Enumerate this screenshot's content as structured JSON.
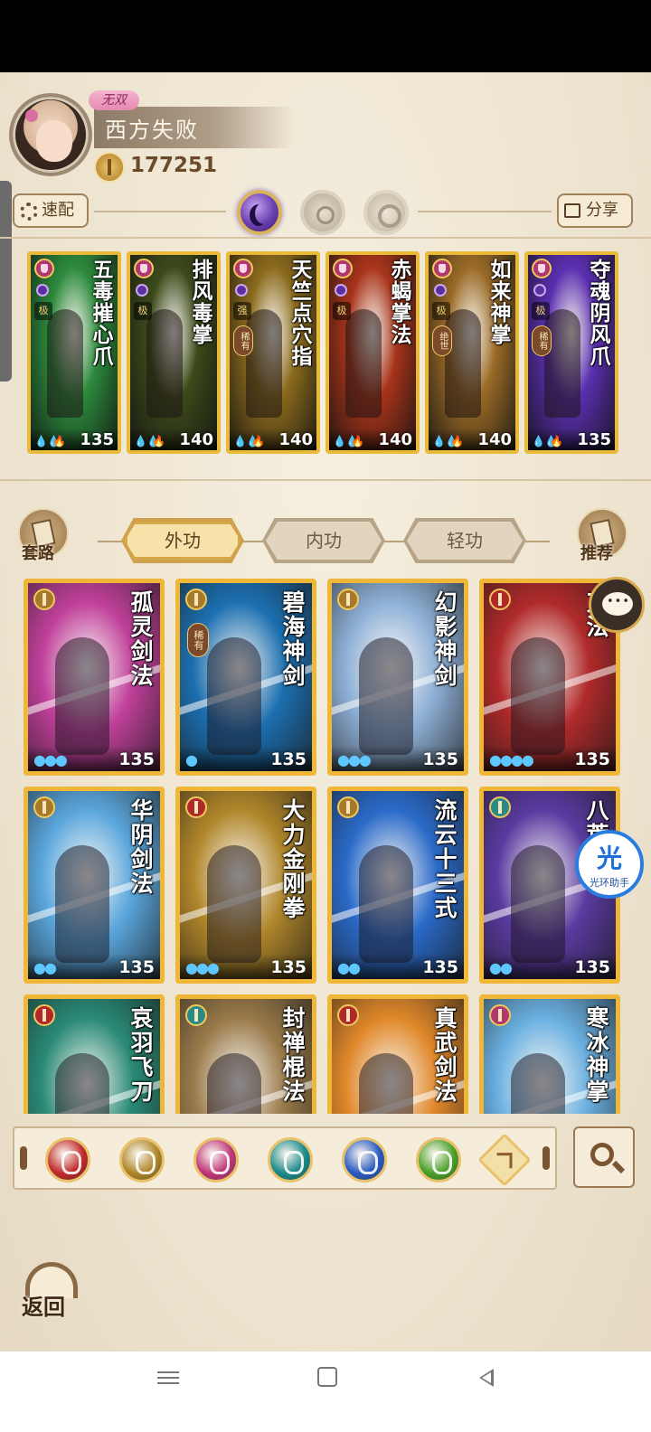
{
  "profile": {
    "title_badge": "无双",
    "player_name": "西方失败",
    "power": "177251"
  },
  "toolbar": {
    "quick_config_label": "速配",
    "share_label": "分享"
  },
  "equipped": [
    {
      "name": "五毒摧心爪",
      "grade": "极",
      "rarity": "",
      "level": "135",
      "bg": "#2c8a3c"
    },
    {
      "name": "排风毒掌",
      "grade": "极",
      "rarity": "",
      "level": "140",
      "bg": "#3c4a1a"
    },
    {
      "name": "天竺点穴指",
      "grade": "强",
      "rarity": "稀有",
      "level": "140",
      "bg": "#8a6a1c"
    },
    {
      "name": "赤蝎掌法",
      "grade": "极",
      "rarity": "",
      "level": "140",
      "bg": "#a8341a"
    },
    {
      "name": "如来神掌",
      "grade": "极",
      "rarity": "绝世",
      "level": "140",
      "bg": "#9a6a26"
    },
    {
      "name": "夺魂阴风爪",
      "grade": "极",
      "rarity": "稀有",
      "level": "135",
      "bg": "#5a2fb0"
    }
  ],
  "side": {
    "left_label": "套路",
    "right_label": "推荐"
  },
  "tabs": [
    {
      "label": "外功",
      "active": true
    },
    {
      "label": "内功",
      "active": false
    },
    {
      "label": "轻功",
      "active": false
    }
  ],
  "skills": [
    {
      "name": "孤灵剑法",
      "rarity": "",
      "level": "135",
      "drops": "999",
      "bg": "#c0409a",
      "badge": "#a67a2a"
    },
    {
      "name": "碧海神剑",
      "rarity": "稀有",
      "level": "135",
      "drops": "9",
      "bg": "#1c6fb0",
      "badge": "#a67a2a"
    },
    {
      "name": "幻影神剑",
      "rarity": "",
      "level": "135",
      "drops": "999",
      "bg": "#8eb0d6",
      "badge": "#a67a2a"
    },
    {
      "name": "刀法",
      "rarity": "",
      "level": "135",
      "drops": "9999",
      "bg": "#b02a2a",
      "badge": "#b0282a"
    },
    {
      "name": "华阴剑法",
      "rarity": "",
      "level": "135",
      "drops": "99",
      "bg": "#5aa6dc",
      "badge": "#a67a2a"
    },
    {
      "name": "大力金刚拳",
      "rarity": "",
      "level": "135",
      "drops": "999",
      "bg": "#b0862a",
      "badge": "#b0282a"
    },
    {
      "name": "流云十三式",
      "rarity": "",
      "level": "135",
      "drops": "99",
      "bg": "#2a6ac8",
      "badge": "#a67a2a"
    },
    {
      "name": "八荒枪",
      "rarity": "",
      "level": "135",
      "drops": "99",
      "bg": "#5a3aa0",
      "badge": "#2a8a8a"
    },
    {
      "name": "哀羽飞刀",
      "rarity": "",
      "level": "",
      "drops": "",
      "bg": "#2a8a76",
      "badge": "#b0282a"
    },
    {
      "name": "封禅棍法",
      "rarity": "",
      "level": "",
      "drops": "",
      "bg": "#9a7a4a",
      "badge": "#2a8a8a"
    },
    {
      "name": "真武剑法",
      "rarity": "",
      "level": "",
      "drops": "",
      "bg": "#e0882a",
      "badge": "#b0282a"
    },
    {
      "name": "寒冰神掌",
      "rarity": "",
      "level": "",
      "drops": "",
      "bg": "#6ab0e0",
      "badge": "#b0386e"
    }
  ],
  "overlays": {
    "helper_big": "光",
    "helper_small": "光环助手"
  },
  "filters": [
    {
      "icon": "blade-icon",
      "color": "#c02a2a"
    },
    {
      "icon": "sword-icon",
      "color": "#b0862a"
    },
    {
      "icon": "palm-icon",
      "color": "#c0387a"
    },
    {
      "icon": "fan-icon",
      "color": "#1a8a8a"
    },
    {
      "icon": "yin-yang-icon",
      "color": "#2a5ac0"
    },
    {
      "icon": "whip-icon",
      "color": "#4aa02a"
    }
  ],
  "back_label": "返回"
}
